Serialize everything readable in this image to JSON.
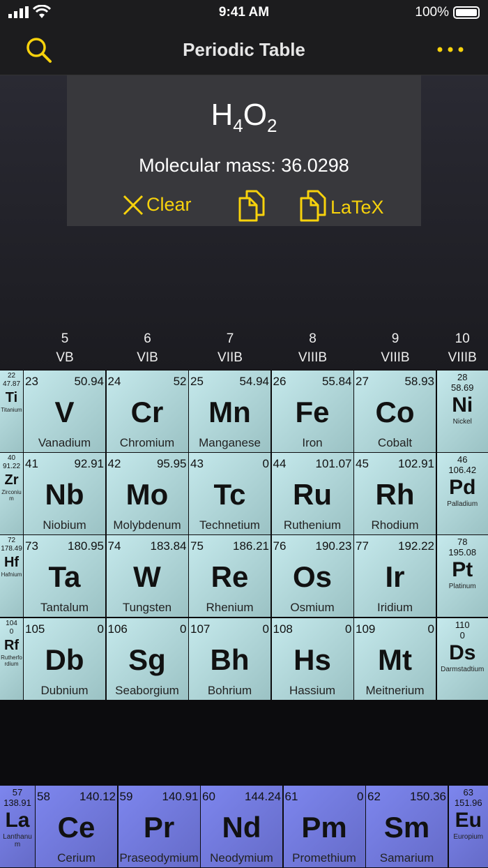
{
  "status": {
    "time": "9:41 AM",
    "battery": "100%"
  },
  "nav": {
    "title": "Periodic Table",
    "search_icon": "search-icon",
    "more_icon": "more-icon"
  },
  "result": {
    "formula_h": "H",
    "formula_h_sub": "4",
    "formula_o": "O",
    "formula_o_sub": "2",
    "mass": "Molecular mass: 36.0298",
    "clear": "Clear",
    "latex": "LaTeX"
  },
  "colors": {
    "accent": "#f7d20c",
    "transition": "#b4dadc",
    "lanthanide": "#737ade"
  },
  "groups": [
    {
      "num": "5",
      "roman": "VB"
    },
    {
      "num": "6",
      "roman": "VIB"
    },
    {
      "num": "7",
      "roman": "VIIB"
    },
    {
      "num": "8",
      "roman": "VIIIB"
    },
    {
      "num": "9",
      "roman": "VIIIB"
    },
    {
      "num": "10",
      "roman": "VIIIB"
    }
  ],
  "rows": [
    [
      {
        "n": "22",
        "m": "47.87",
        "s": "Ti",
        "nm": "Titanium"
      },
      {
        "n": "23",
        "m": "50.94",
        "s": "V",
        "nm": "Vanadium"
      },
      {
        "n": "24",
        "m": "52",
        "s": "Cr",
        "nm": "Chromium"
      },
      {
        "n": "25",
        "m": "54.94",
        "s": "Mn",
        "nm": "Manganese"
      },
      {
        "n": "26",
        "m": "55.84",
        "s": "Fe",
        "nm": "Iron"
      },
      {
        "n": "27",
        "m": "58.93",
        "s": "Co",
        "nm": "Cobalt"
      },
      {
        "n": "28",
        "m": "58.69",
        "s": "Ni",
        "nm": "Nickel"
      }
    ],
    [
      {
        "n": "40",
        "m": "91.22",
        "s": "Zr",
        "nm": "Zirconium"
      },
      {
        "n": "41",
        "m": "92.91",
        "s": "Nb",
        "nm": "Niobium"
      },
      {
        "n": "42",
        "m": "95.95",
        "s": "Mo",
        "nm": "Molybdenum"
      },
      {
        "n": "43",
        "m": "0",
        "s": "Tc",
        "nm": "Technetium"
      },
      {
        "n": "44",
        "m": "101.07",
        "s": "Ru",
        "nm": "Ruthenium"
      },
      {
        "n": "45",
        "m": "102.91",
        "s": "Rh",
        "nm": "Rhodium"
      },
      {
        "n": "46",
        "m": "106.42",
        "s": "Pd",
        "nm": "Palladium"
      }
    ],
    [
      {
        "n": "72",
        "m": "178.49",
        "s": "Hf",
        "nm": "Hafnium"
      },
      {
        "n": "73",
        "m": "180.95",
        "s": "Ta",
        "nm": "Tantalum"
      },
      {
        "n": "74",
        "m": "183.84",
        "s": "W",
        "nm": "Tungsten"
      },
      {
        "n": "75",
        "m": "186.21",
        "s": "Re",
        "nm": "Rhenium"
      },
      {
        "n": "76",
        "m": "190.23",
        "s": "Os",
        "nm": "Osmium"
      },
      {
        "n": "77",
        "m": "192.22",
        "s": "Ir",
        "nm": "Iridium"
      },
      {
        "n": "78",
        "m": "195.08",
        "s": "Pt",
        "nm": "Platinum"
      }
    ],
    [
      {
        "n": "104",
        "m": "0",
        "s": "Rf",
        "nm": "Rutherfordium"
      },
      {
        "n": "105",
        "m": "0",
        "s": "Db",
        "nm": "Dubnium"
      },
      {
        "n": "106",
        "m": "0",
        "s": "Sg",
        "nm": "Seaborgium"
      },
      {
        "n": "107",
        "m": "0",
        "s": "Bh",
        "nm": "Bohrium"
      },
      {
        "n": "108",
        "m": "0",
        "s": "Hs",
        "nm": "Hassium"
      },
      {
        "n": "109",
        "m": "0",
        "s": "Mt",
        "nm": "Meitnerium"
      },
      {
        "n": "110",
        "m": "0",
        "s": "Ds",
        "nm": "Darmstadtium"
      }
    ]
  ],
  "lanthanides": [
    {
      "n": "57",
      "m": "138.91",
      "s": "La",
      "nm": "Lanthanum"
    },
    {
      "n": "58",
      "m": "140.12",
      "s": "Ce",
      "nm": "Cerium"
    },
    {
      "n": "59",
      "m": "140.91",
      "s": "Pr",
      "nm": "Praseodymium"
    },
    {
      "n": "60",
      "m": "144.24",
      "s": "Nd",
      "nm": "Neodymium"
    },
    {
      "n": "61",
      "m": "0",
      "s": "Pm",
      "nm": "Promethium"
    },
    {
      "n": "62",
      "m": "150.36",
      "s": "Sm",
      "nm": "Samarium"
    },
    {
      "n": "63",
      "m": "151.96",
      "s": "Eu",
      "nm": "Europium"
    }
  ]
}
